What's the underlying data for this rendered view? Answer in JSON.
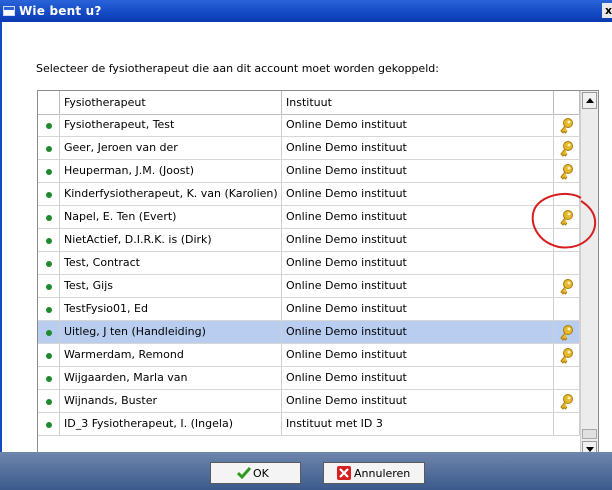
{
  "window": {
    "title": "Wie bent u?",
    "close_glyph": "x"
  },
  "instruction": "Selecteer de fysiotherapeut die aan dit account moet worden gekoppeld:",
  "table": {
    "headers": [
      "Fysiotherapeut",
      "Instituut"
    ],
    "rows": [
      {
        "name": "Fysiotherapeut, Test",
        "institute": "Online Demo instituut",
        "key": true,
        "selected": false
      },
      {
        "name": "Geer, Jeroen van der",
        "institute": "Online Demo instituut",
        "key": true,
        "selected": false
      },
      {
        "name": "Heuperman, J.M.  (Joost)",
        "institute": "Online Demo instituut",
        "key": true,
        "selected": false
      },
      {
        "name": "Kinderfysiotherapeut, K. van (Karolien)",
        "institute": "Online Demo instituut",
        "key": false,
        "selected": false
      },
      {
        "name": "Napel, E. Ten (Evert)",
        "institute": "Online Demo instituut",
        "key": true,
        "selected": false
      },
      {
        "name": "NietActief, D.I.R.K. is (Dirk)",
        "institute": "Online Demo instituut",
        "key": false,
        "selected": false
      },
      {
        "name": "Test, Contract",
        "institute": "Online Demo instituut",
        "key": false,
        "selected": false
      },
      {
        "name": "Test, Gijs",
        "institute": "Online Demo instituut",
        "key": true,
        "selected": false
      },
      {
        "name": "TestFysio01, Ed",
        "institute": "Online Demo instituut",
        "key": false,
        "selected": false
      },
      {
        "name": "Uitleg, J ten (Handleiding)",
        "institute": "Online Demo instituut",
        "key": true,
        "selected": true
      },
      {
        "name": "Warmerdam, Remond",
        "institute": "Online Demo instituut",
        "key": true,
        "selected": false
      },
      {
        "name": "Wijgaarden, Marla van",
        "institute": "Online Demo instituut",
        "key": false,
        "selected": false
      },
      {
        "name": "Wijnands, Buster",
        "institute": "Online Demo instituut",
        "key": true,
        "selected": false
      },
      {
        "name": "ID_3 Fysiotherapeut, I.  (Ingela)",
        "institute": "Instituut met ID 3",
        "key": false,
        "selected": false
      }
    ]
  },
  "buttons": {
    "ok": "OK",
    "cancel": "Annuleren"
  },
  "icons": {
    "active": "green-dot-icon",
    "key": "key-icon",
    "ok": "checkmark-icon",
    "cancel": "red-x-icon"
  },
  "colors": {
    "titlebar": "#1349c3",
    "selected_row": "#b8cdf0",
    "active_dot": "#1f8a2c",
    "key": "#d4a017",
    "annotation": "#d81e1e"
  }
}
